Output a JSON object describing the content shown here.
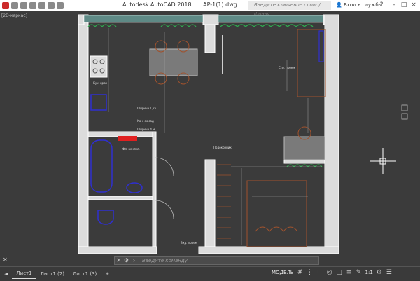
{
  "app": {
    "title": "Autodesk AutoCAD 2018",
    "file": "AP-1(1).dwg",
    "search_placeholder": "Введите ключевое слово/фразу",
    "signin": "Вход в службы"
  },
  "viewport": {
    "label": "[2D-каркас]"
  },
  "plan_labels": {
    "label_a": "Ширина 1,25",
    "label_b": "Кон. фасад",
    "label_c": "Ширина 4 м",
    "label_d": "Фл. вентил.",
    "label_e": "Кух. кран",
    "label_f": "Подоконник",
    "label_g": "Вид. проем",
    "label_h": "Стр. проем"
  },
  "command": {
    "placeholder": "Введите команду"
  },
  "layout_tabs": [
    "Лист1",
    "Лист1 (2)",
    "Лист1 (3)"
  ],
  "add_tab": "+",
  "status": {
    "model": "МОДЕЛЬ",
    "scale": "1:1"
  },
  "colors": {
    "background": "#3b3b3b",
    "wall": "#ffffff",
    "furniture": "#a0522d",
    "plumbing": "#2f2fd0",
    "plants": "#2fa84f",
    "marker": "#e02020"
  }
}
